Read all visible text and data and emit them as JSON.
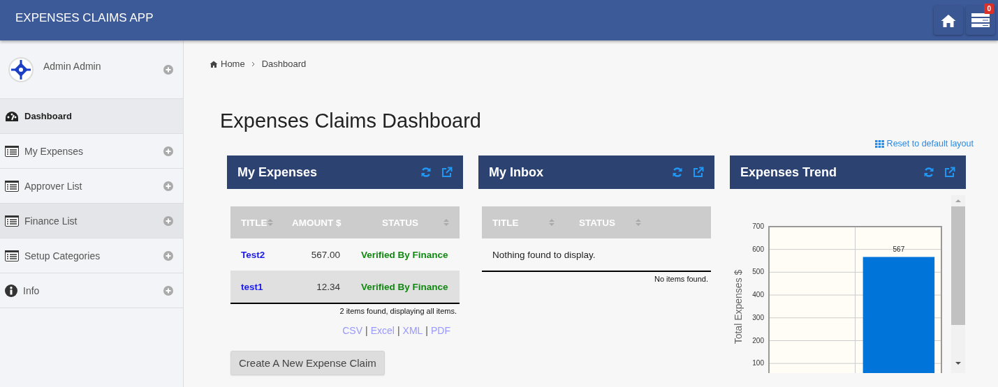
{
  "header": {
    "title": "EXPENSES CLAIMS APP",
    "notification_count": "0"
  },
  "sidebar": {
    "user": "Admin Admin",
    "items": [
      {
        "label": "Dashboard",
        "kind": "dashboard",
        "selected": true,
        "hovered": false,
        "expandable": false
      },
      {
        "label": "My Expenses",
        "kind": "list",
        "selected": false,
        "hovered": false,
        "expandable": true
      },
      {
        "label": "Approver List",
        "kind": "list",
        "selected": false,
        "hovered": false,
        "expandable": true
      },
      {
        "label": "Finance List",
        "kind": "list",
        "selected": false,
        "hovered": true,
        "expandable": true
      },
      {
        "label": "Setup Categories",
        "kind": "list",
        "selected": false,
        "hovered": false,
        "expandable": true
      },
      {
        "label": "Info",
        "kind": "info",
        "selected": false,
        "hovered": false,
        "expandable": true
      }
    ]
  },
  "breadcrumb": [
    {
      "label": "Home"
    },
    {
      "label": "Dashboard"
    }
  ],
  "page_title": "Expenses Claims Dashboard",
  "reset_link": "Reset to default layout",
  "panels": [
    {
      "title": "My Expenses",
      "kind": "table",
      "columns": [
        {
          "label": "TITLE",
          "sortable": true
        },
        {
          "label": "AMOUNT $",
          "sortable": false
        },
        {
          "label": "STATUS",
          "sortable": true
        }
      ],
      "rows": [
        {
          "cells": [
            "Test2",
            "567.00",
            "Verified By Finance"
          ]
        },
        {
          "cells": [
            "test1",
            "12.34",
            "Verified By Finance"
          ]
        }
      ],
      "footer": "2 items found, displaying all items.",
      "exports": [
        "CSV",
        "Excel",
        "XML",
        "PDF"
      ],
      "export_separator": "|",
      "button": "Create A New Expense Claim"
    },
    {
      "title": "My Inbox",
      "kind": "table",
      "columns": [
        {
          "label": "TITLE",
          "sortable": true
        },
        {
          "label": "STATUS",
          "sortable": true
        }
      ],
      "empty_message": "Nothing found to display.",
      "footer": "No items found."
    },
    {
      "title": "Expenses Trend",
      "kind": "chart",
      "chart_data": {
        "type": "bar",
        "ylabel": "Total Expenses $",
        "ylim": [
          0,
          700
        ],
        "grid": true,
        "yticks": [
          100,
          200,
          300,
          400,
          500,
          600,
          700
        ],
        "data_labels": true,
        "series": [
          {
            "color": "#0074d9",
            "values": [
              null,
              567
            ]
          }
        ]
      }
    }
  ]
}
